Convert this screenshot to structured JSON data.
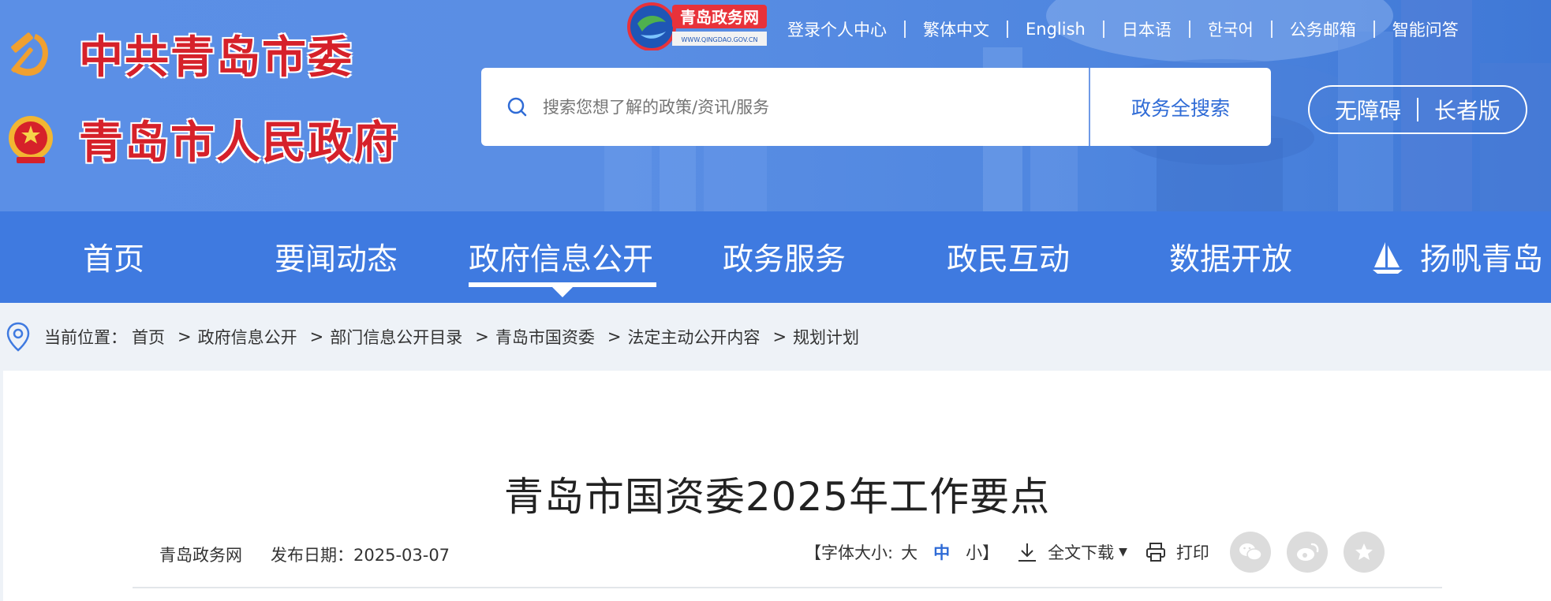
{
  "header": {
    "org_party": "中共青岛市委",
    "org_gov": "青岛市人民政府",
    "portal_logo_text": "青岛政务网",
    "portal_logo_url_text": "WWW.QINGDAO.GOV.CN",
    "top_links": [
      "登录个人中心",
      "繁体中文",
      "English",
      "日本语",
      "한국어",
      "公务邮箱",
      "智能问答"
    ],
    "search": {
      "placeholder": "搜索您想了解的政策/资讯/服务",
      "button": "政务全搜索"
    },
    "accessibility": {
      "barrier_free": "无障碍",
      "elderly": "长者版"
    }
  },
  "nav": {
    "items": [
      "首页",
      "要闻动态",
      "政府信息公开",
      "政务服务",
      "政民互动",
      "数据开放",
      "扬帆青岛"
    ],
    "active_index": 2
  },
  "breadcrumb": {
    "label": "当前位置：",
    "items": [
      "首页",
      "政府信息公开",
      "部门信息公开目录",
      "青岛市国资委",
      "法定主动公开内容",
      "规划计划"
    ],
    "separator": ">"
  },
  "article": {
    "title": "青岛市国资委2025年工作要点",
    "source": "青岛政务网",
    "publish_date": "发布日期：2025-03-07",
    "font_size_open": "【字体大小:",
    "font_sizes": [
      "大",
      "中",
      "小"
    ],
    "font_size_active": 1,
    "font_size_close": "】",
    "download": "全文下载",
    "print": "打印"
  },
  "icons": {
    "search": "search-icon",
    "location": "location-pin-icon",
    "download": "download-icon",
    "print": "print-icon",
    "wechat": "wechat-icon",
    "weibo": "weibo-icon",
    "favorite": "star-icon",
    "sail": "sail-icon"
  },
  "colors": {
    "nav_bg": "#3f7ae0",
    "header_bg": "#5a8ee4",
    "accent": "#2f6bd6",
    "org_red": "#d6212a"
  }
}
